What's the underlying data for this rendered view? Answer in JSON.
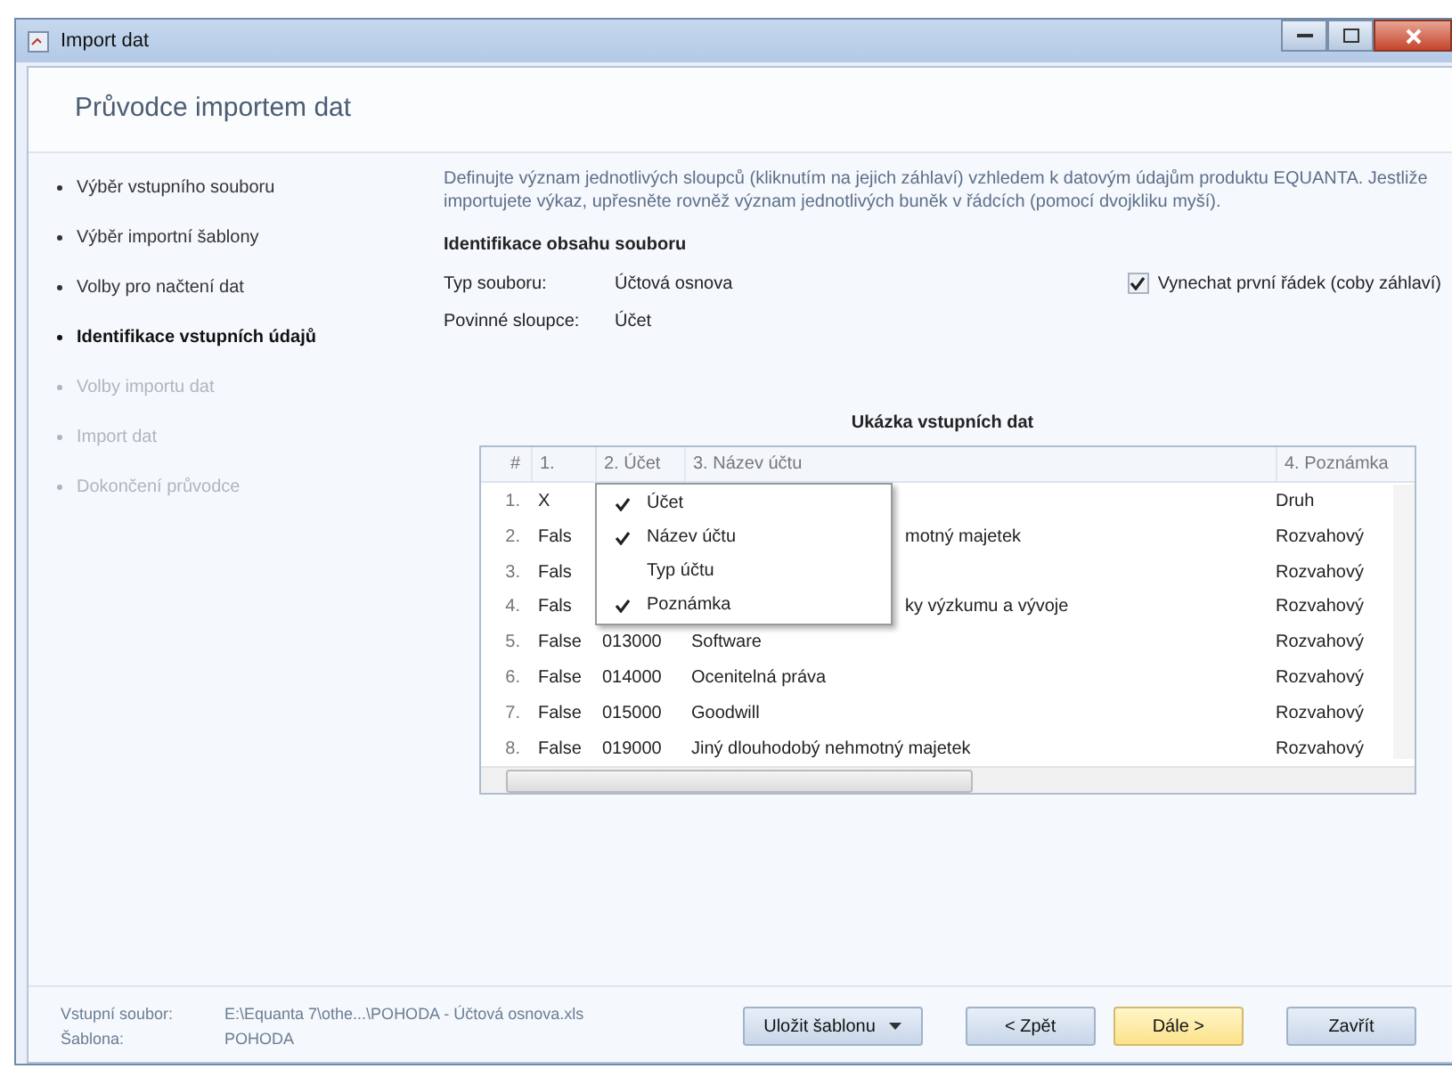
{
  "window": {
    "title": "Import dat"
  },
  "wizard": {
    "title": "Průvodce importem dat"
  },
  "steps": [
    {
      "label": "Výběr vstupního souboru",
      "selected": false,
      "disabled": false
    },
    {
      "label": "Výběr importní šablony",
      "selected": false,
      "disabled": false
    },
    {
      "label": "Volby pro načtení dat",
      "selected": false,
      "disabled": false
    },
    {
      "label": "Identifikace vstupních údajů",
      "selected": true,
      "disabled": false
    },
    {
      "label": "Volby importu dat",
      "selected": false,
      "disabled": true
    },
    {
      "label": "Import dat",
      "selected": false,
      "disabled": true
    },
    {
      "label": "Dokončení průvodce",
      "selected": false,
      "disabled": true
    }
  ],
  "description": "Definujte význam jednotlivých sloupců (kliknutím na jejich záhlaví) vzhledem k datovým údajům produktu EQUANTA. Jestliže importujete výkaz, upřesněte rovněž význam jednotlivých buněk v řádcích (pomocí dvojkliku myší).",
  "section_title": "Identifikace obsahu souboru",
  "fields": [
    {
      "label": "Typ souboru:",
      "value": "Účtová osnova"
    },
    {
      "label": "Povinné sloupce:",
      "value": "Účet"
    }
  ],
  "skip_header": {
    "label": "Vynechat první řádek (coby záhlaví)",
    "checked": true
  },
  "preview": {
    "title": "Ukázka vstupních dat",
    "columns": [
      "#",
      "1.",
      "2. Účet",
      "3. Název účtu",
      "4. Poznámka"
    ],
    "rows": [
      {
        "number": "1.",
        "column_1": "X",
        "column_4": "Druh"
      },
      {
        "number": "2.",
        "column_1": "Fals",
        "column_3": "motný majetek",
        "column_4": "Rozvahový"
      },
      {
        "number": "3.",
        "column_1": "Fals",
        "column_4": "Rozvahový"
      },
      {
        "number": "4.",
        "column_1": "Fals",
        "column_3": "ky výzkumu a vývoje",
        "column_4": "Rozvahový"
      },
      {
        "number": "5.",
        "column_1": "False",
        "column_2": "013000",
        "column_3": "Software",
        "column_4": "Rozvahový"
      },
      {
        "number": "6.",
        "column_1": "False",
        "column_2": "014000",
        "column_3": "Ocenitelná práva",
        "column_4": "Rozvahový"
      },
      {
        "number": "7.",
        "column_1": "False",
        "column_2": "015000",
        "column_3": "Goodwill",
        "column_4": "Rozvahový"
      },
      {
        "number": "8.",
        "column_1": "False",
        "column_2": "019000",
        "column_3": "Jiný dlouhodobý nehmotný majetek",
        "column_4": "Rozvahový"
      }
    ],
    "menu": [
      {
        "label": "Účet",
        "checked": true
      },
      {
        "label": "Název účtu",
        "checked": true
      },
      {
        "label": "Typ účtu",
        "checked": false
      },
      {
        "label": "Poznámka",
        "checked": true
      }
    ]
  },
  "footer": {
    "info": [
      {
        "label": "Vstupní soubor:",
        "value": "E:\\Equanta 7\\othe...\\POHODA - Účtová osnova.xls"
      },
      {
        "label": "Šablona:",
        "value": "POHODA"
      }
    ],
    "buttons": [
      {
        "label": "Uložit šablonu",
        "kind": "dropdown",
        "selected": false
      },
      {
        "label": "< Zpět",
        "kind": "plain",
        "selected": false
      },
      {
        "label": "Dále >",
        "kind": "plain",
        "selected": true
      },
      {
        "label": "Zavřít",
        "kind": "plain",
        "selected": false
      }
    ]
  }
}
